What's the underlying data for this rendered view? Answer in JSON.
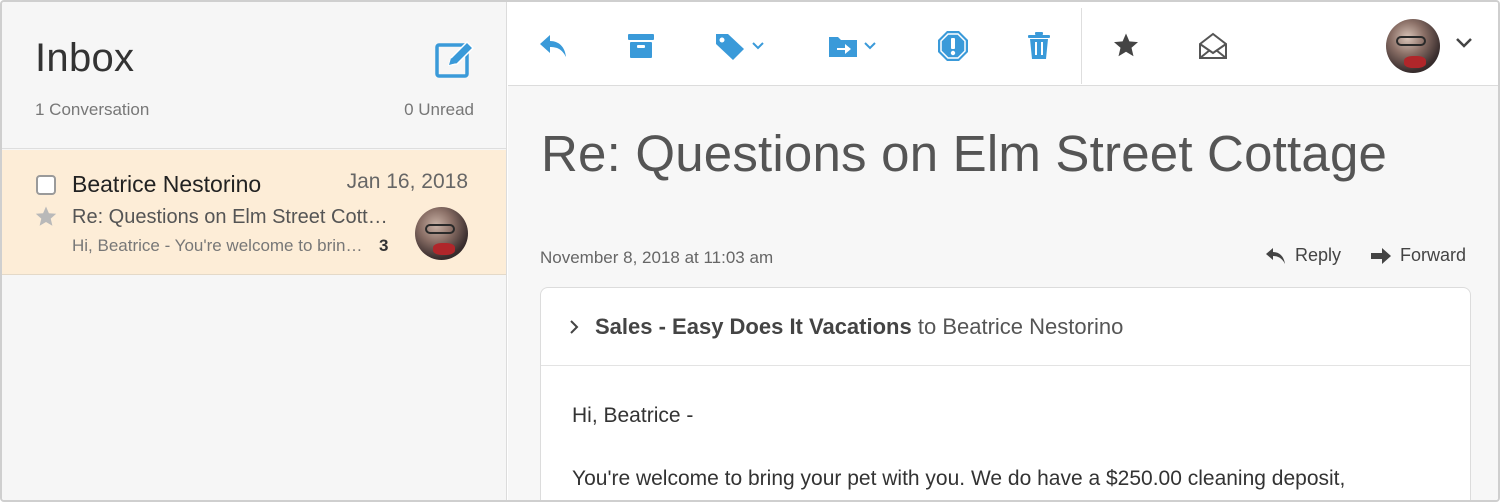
{
  "inbox": {
    "title": "Inbox",
    "conversation_count": "1 Conversation",
    "unread_count": "0 Unread"
  },
  "message_list": [
    {
      "sender": "Beatrice Nestorino",
      "date": "Jan 16, 2018",
      "subject": "Re: Questions on Elm Street Cottage",
      "preview": "Hi, Beatrice - You're welcome to bring your pet with you.",
      "thread_count": "3"
    }
  ],
  "toolbar": {
    "icons": [
      "reply-icon",
      "archive-icon",
      "tag-icon",
      "move-to-folder-icon",
      "spam-icon",
      "trash-icon",
      "star-icon",
      "mark-unread-icon"
    ],
    "accent_color": "#3a9ad9"
  },
  "email": {
    "subject": "Re: Questions on Elm Street Cottage",
    "timestamp": "November 8, 2018 at 11:03 am",
    "reply_label": "Reply",
    "forward_label": "Forward",
    "from": "Sales - Easy Does It Vacations",
    "to_word": "to",
    "to": "Beatrice Nestorino",
    "greeting": "Hi, Beatrice -",
    "body_line": "You're welcome to bring your pet with you. We do have a $250.00 cleaning deposit,"
  },
  "colors": {
    "selected_row": "#fdedd7",
    "accent": "#3a9ad9"
  }
}
